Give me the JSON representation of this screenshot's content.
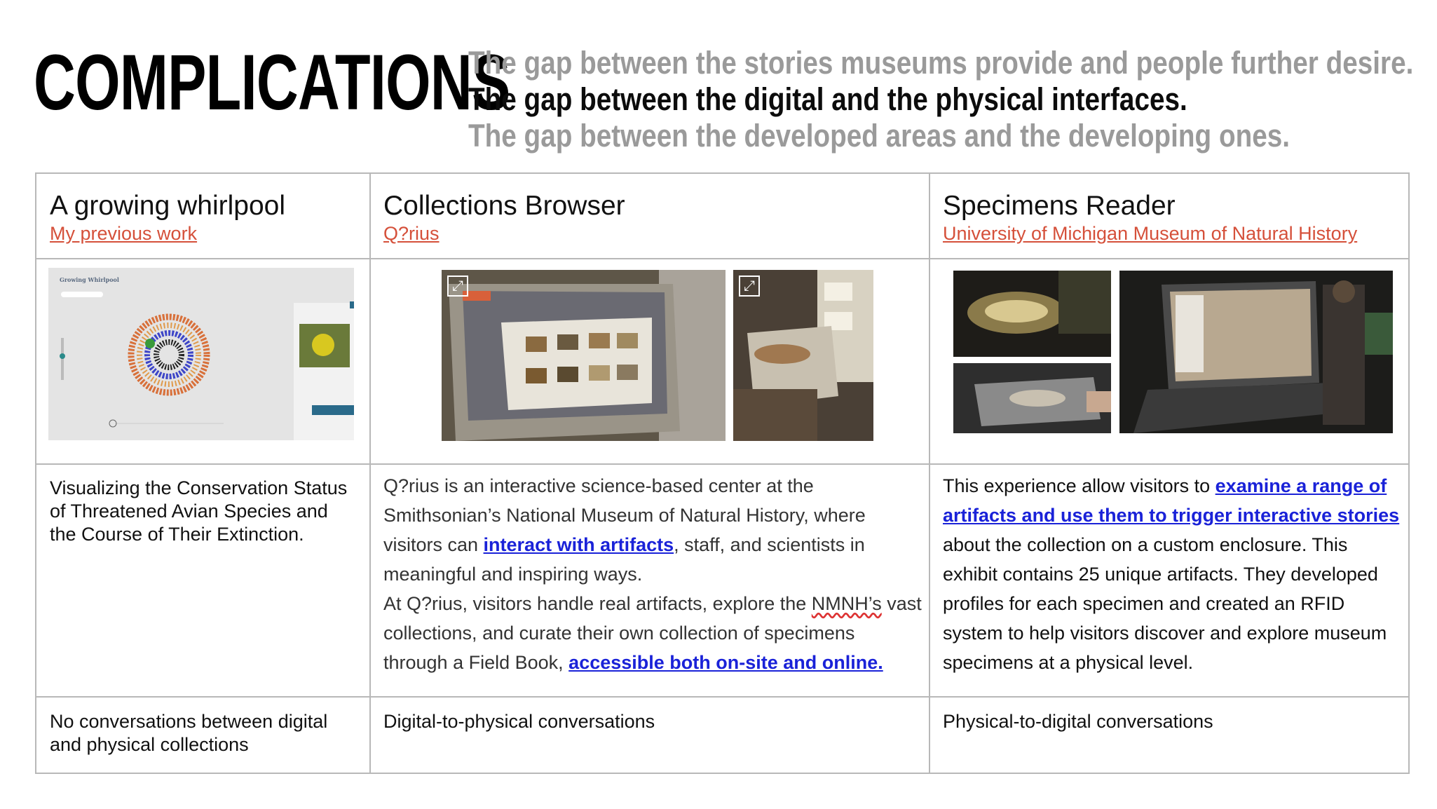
{
  "header": {
    "title": "COMPLICATIONS",
    "gaps": [
      "The gap between the stories museums provide and people further desire.",
      "The gap between the digital and the physical interfaces.",
      "The gap between the developed areas and the developing ones."
    ],
    "active_gap_index": 1
  },
  "columns": [
    {
      "title": "A growing whirlpool",
      "subtitle": "My previous work",
      "image_label": "Growing Whirlpool",
      "description": "Visualizing the Conservation Status of Threatened Avian Species and the Course of Their Extinction.",
      "conversation": "No conversations between digital and physical collections"
    },
    {
      "title": "Collections Browser",
      "subtitle": "Q?rius",
      "description": {
        "p1_a": "Q?rius is an interactive science-based center at the Smithsonian’s National Museum of Natural History, where visitors can ",
        "p1_link": "interact with artifacts",
        "p1_b": ", staff, and scientists in meaningful and inspiring ways.",
        "p2_a": "At Q?rius, visitors handle real artifacts, explore the ",
        "p2_flag": "NMNH’s",
        "p2_b": " vast collections, and curate their own collection of specimens through a Field Book, ",
        "p2_link": "accessible both on-site and online."
      },
      "conversation": "Digital-to-physical conversations"
    },
    {
      "title": "Specimens Reader",
      "subtitle": "University of Michigan Museum of Natural History",
      "description": {
        "a": "This experience allow visitors to ",
        "link": "examine a range of artifacts and use them to trigger interactive stories",
        "b": " about the collection on a custom enclosure. This exhibit contains 25 unique artifacts. They developed profiles for each specimen and created an RFID system to help visitors discover and explore museum specimens at a physical level."
      },
      "conversation": "Physical-to-digital conversations"
    }
  ],
  "colors": {
    "accent_link": "#d5503a",
    "body_link": "#1a22d8",
    "muted_gap": "#9a9a9a",
    "grid_line": "#b8b8b8"
  }
}
